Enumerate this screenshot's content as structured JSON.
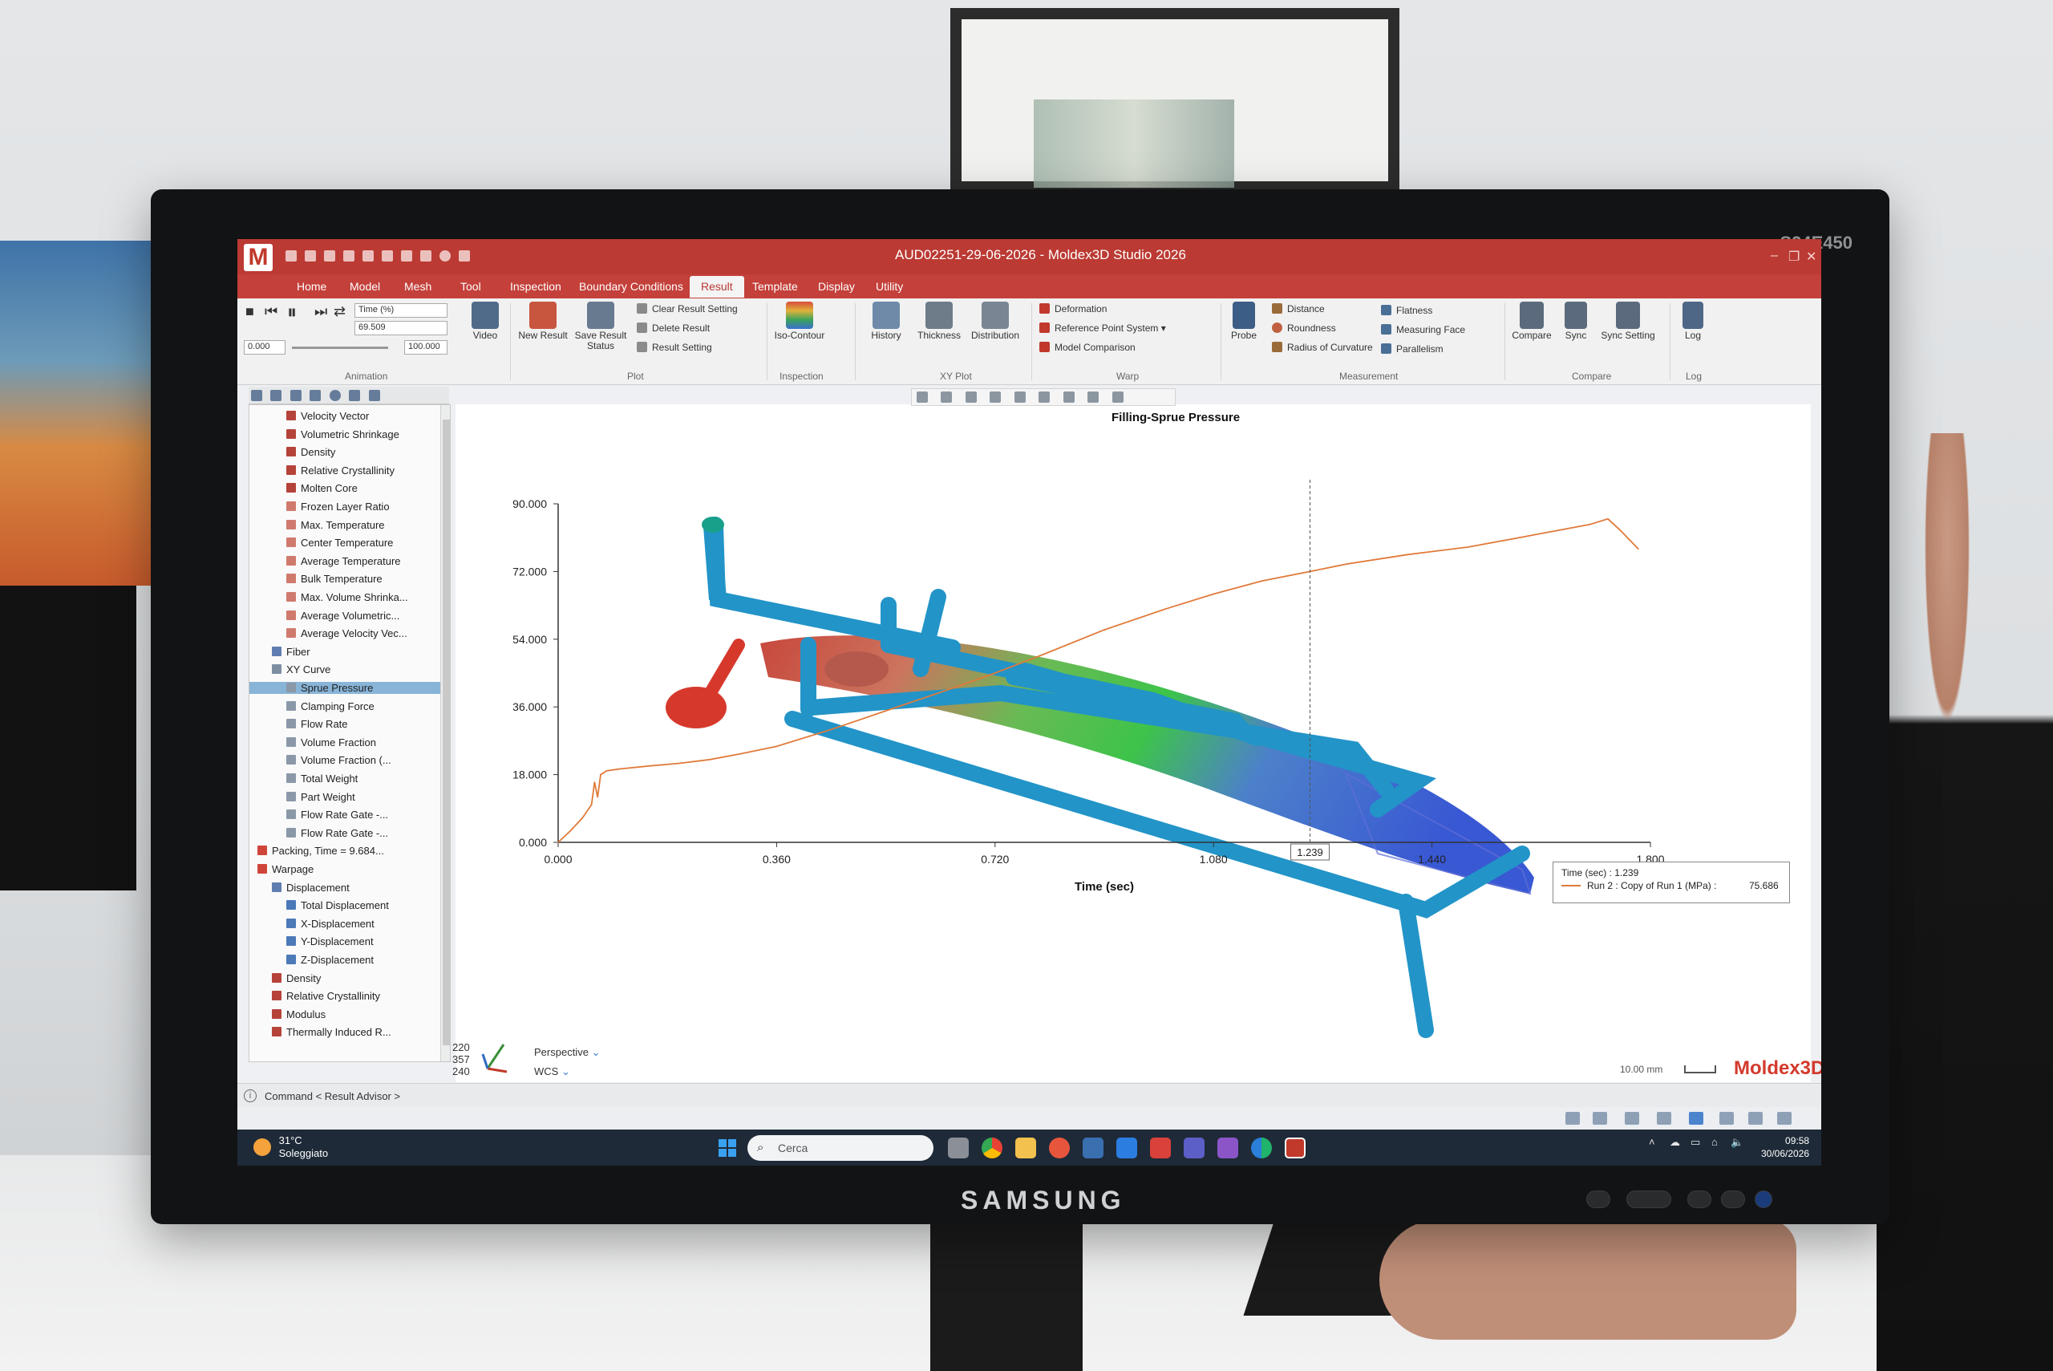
{
  "monitor": {
    "model": "S24E450",
    "brand": "SAMSUNG"
  },
  "window": {
    "title": "AUD02251-29-06-2026 - Moldex3D Studio 2026",
    "logo_letter": "M"
  },
  "menu": {
    "tabs": [
      "Home",
      "Model",
      "Mesh",
      "Tool",
      "Inspection",
      "Boundary Conditions",
      "Result",
      "Template",
      "Display",
      "Utility"
    ],
    "active": "Result"
  },
  "ribbon": {
    "animation": {
      "group_label": "Animation",
      "mode_select": "Time (%)",
      "current_value": "69.509",
      "start_value": "0.000",
      "end_value": "100.000",
      "video_label": "Video"
    },
    "plot": {
      "group_label": "Plot",
      "new_result": "New Result",
      "save_result_status": "Save Result Status",
      "clear_result_setting": "Clear Result Setting",
      "delete_result": "Delete Result",
      "result_setting": "Result Setting"
    },
    "inspection": {
      "group_label": "Inspection",
      "iso_contour": "Iso-Contour"
    },
    "xyplot": {
      "group_label": "XY Plot",
      "history": "History",
      "thickness": "Thickness",
      "distribution": "Distribution"
    },
    "warp": {
      "group_label": "Warp",
      "deformation": "Deformation",
      "reference_point_system": "Reference Point System",
      "model_comparison": "Model Comparison"
    },
    "measurement": {
      "group_label": "Measurement",
      "probe": "Probe",
      "distance": "Distance",
      "roundness": "Roundness",
      "radius_of_curvature": "Radius of Curvature",
      "flatness": "Flatness",
      "measuring_face": "Measuring Face",
      "parallelism": "Parallelism"
    },
    "compare": {
      "group_label": "Compare",
      "compare": "Compare",
      "sync": "Sync",
      "sync_setting": "Sync Setting"
    },
    "log": {
      "group_label": "Log",
      "log": "Log"
    }
  },
  "tree": {
    "items": [
      {
        "label": "Velocity Vector",
        "indent": 3,
        "icon": "result-icon"
      },
      {
        "label": "Volumetric Shrinkage",
        "indent": 3,
        "icon": "result-icon"
      },
      {
        "label": "Density",
        "indent": 3,
        "icon": "result-icon"
      },
      {
        "label": "Relative Crystallinity",
        "indent": 3,
        "icon": "result-icon"
      },
      {
        "label": "Molten Core",
        "indent": 3,
        "icon": "result-icon"
      },
      {
        "label": "Frozen Layer Ratio",
        "indent": 3,
        "icon": "result-outline-icon"
      },
      {
        "label": "Max. Temperature",
        "indent": 3,
        "icon": "result-outline-icon"
      },
      {
        "label": "Center Temperature",
        "indent": 3,
        "icon": "result-outline-icon"
      },
      {
        "label": "Average Temperature",
        "indent": 3,
        "icon": "result-outline-icon"
      },
      {
        "label": "Bulk Temperature",
        "indent": 3,
        "icon": "result-outline-icon"
      },
      {
        "label": "Max. Volume Shrinka...",
        "indent": 3,
        "icon": "result-outline-icon"
      },
      {
        "label": "Average Volumetric...",
        "indent": 3,
        "icon": "result-outline-icon"
      },
      {
        "label": "Average Velocity Vec...",
        "indent": 3,
        "icon": "result-outline-icon"
      },
      {
        "label": "Fiber",
        "indent": 2,
        "icon": "folder-icon"
      },
      {
        "label": "XY Curve",
        "indent": 2,
        "icon": "curve-folder-icon"
      },
      {
        "label": "Sprue Pressure",
        "indent": 3,
        "icon": "curve-icon",
        "selected": true
      },
      {
        "label": "Clamping Force",
        "indent": 3,
        "icon": "curve-icon"
      },
      {
        "label": "Flow Rate",
        "indent": 3,
        "icon": "curve-icon"
      },
      {
        "label": "Volume Fraction",
        "indent": 3,
        "icon": "curve-icon"
      },
      {
        "label": "Volume Fraction (...",
        "indent": 3,
        "icon": "curve-icon"
      },
      {
        "label": "Total Weight",
        "indent": 3,
        "icon": "curve-icon"
      },
      {
        "label": "Part Weight",
        "indent": 3,
        "icon": "curve-icon"
      },
      {
        "label": "Flow Rate Gate -...",
        "indent": 3,
        "icon": "curve-icon"
      },
      {
        "label": "Flow Rate Gate -...",
        "indent": 3,
        "icon": "curve-icon"
      },
      {
        "label": "Packing, Time = 9.684...",
        "indent": 1,
        "icon": "stage-icon"
      },
      {
        "label": "Warpage",
        "indent": 1,
        "icon": "stage-icon"
      },
      {
        "label": "Displacement",
        "indent": 2,
        "icon": "folder-icon"
      },
      {
        "label": "Total Displacement",
        "indent": 3,
        "icon": "disp-icon"
      },
      {
        "label": "X-Displacement",
        "indent": 3,
        "icon": "disp-icon"
      },
      {
        "label": "Y-Displacement",
        "indent": 3,
        "icon": "disp-icon"
      },
      {
        "label": "Z-Displacement",
        "indent": 3,
        "icon": "disp-icon"
      },
      {
        "label": "Density",
        "indent": 2,
        "icon": "result-icon"
      },
      {
        "label": "Relative Crystallinity",
        "indent": 2,
        "icon": "result-icon"
      },
      {
        "label": "Modulus",
        "indent": 2,
        "icon": "result-icon"
      },
      {
        "label": "Thermally Induced R...",
        "indent": 2,
        "icon": "result-icon"
      }
    ]
  },
  "chart_data": {
    "type": "line",
    "title": "Filling-Sprue Pressure",
    "xlabel": "Time (sec)",
    "ylabel": "",
    "xlim": [
      0,
      1.8
    ],
    "ylim": [
      0,
      90
    ],
    "x_ticks": [
      "0.000",
      "0.360",
      "0.720",
      "1.080",
      "1.440",
      "1.800"
    ],
    "y_ticks": [
      "0.000",
      "18.000",
      "36.000",
      "54.000",
      "72.000",
      "90.000"
    ],
    "grid": false,
    "series": [
      {
        "name": "Run 2 : Copy of Run 1 (MPa)",
        "color": "#e07a3a",
        "x": [
          0.0,
          0.02,
          0.04,
          0.055,
          0.06,
          0.065,
          0.07,
          0.08,
          0.1,
          0.15,
          0.2,
          0.25,
          0.3,
          0.36,
          0.45,
          0.55,
          0.65,
          0.72,
          0.8,
          0.9,
          1.0,
          1.08,
          1.16,
          1.239,
          1.3,
          1.4,
          1.5,
          1.6,
          1.7,
          1.73,
          1.75,
          1.78
        ],
        "values": [
          0.0,
          3.0,
          6.5,
          10.0,
          16.0,
          12.0,
          18.0,
          19.0,
          19.5,
          20.3,
          21.0,
          22.0,
          23.5,
          25.5,
          30.0,
          35.5,
          41.0,
          45.0,
          50.0,
          56.5,
          62.0,
          66.0,
          69.5,
          72.0,
          74.0,
          76.5,
          78.5,
          81.5,
          84.5,
          86.0,
          83.0,
          78.0
        ]
      }
    ],
    "cursor": {
      "x_label": "1.239",
      "tooltip_line1": "Time (sec) : 1.239",
      "tooltip_series": "Run 2 : Copy of Run 1 (MPa) :",
      "tooltip_value": "75.686"
    }
  },
  "view": {
    "coords": [
      "220",
      "357",
      "240"
    ],
    "projection": "Perspective",
    "coordinate_system": "WCS",
    "scale_label": "10.00 mm",
    "logo": "Moldex3D"
  },
  "command_bar": {
    "text": "Command < Result Advisor >"
  },
  "taskbar": {
    "weather_temp": "31°C",
    "weather_desc": "Soleggiato",
    "search_placeholder": "Cerca",
    "time": "09:58",
    "date": "30/06/2026"
  },
  "colors": {
    "title_red": "#bb3a33",
    "accent_red": "#d33a2c",
    "curve_orange": "#e07a3a",
    "selection_blue": "#88b4d8",
    "runner_blue": "#1e93c8"
  }
}
